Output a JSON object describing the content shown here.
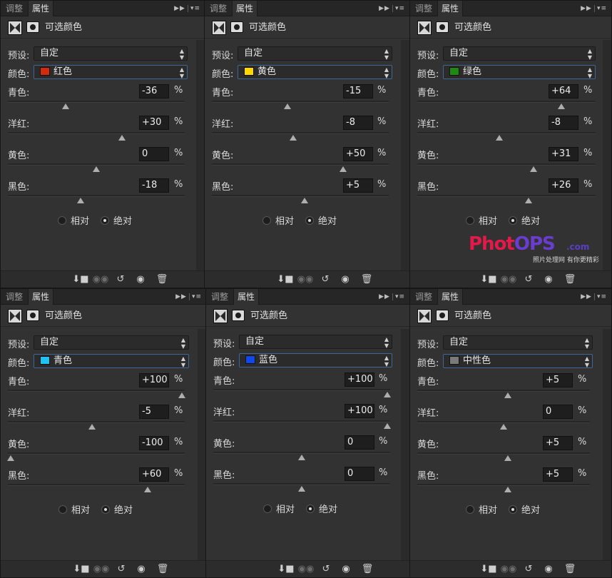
{
  "common": {
    "tab_adjust": "调整",
    "tab_properties": "属性",
    "panel_title": "可选颜色",
    "preset_label": "预设:",
    "preset_value": "自定",
    "color_label": "颜色:",
    "slider_labels": [
      "青色:",
      "洋红:",
      "黄色:",
      "黑色:"
    ],
    "percent": "%",
    "relative": "相对",
    "absolute": "绝对",
    "method": "absolute"
  },
  "panels": [
    {
      "color_name": "红色",
      "swatch": "#d62a0f",
      "values": [
        "-36",
        "+30",
        "0",
        "-18"
      ],
      "levels": [
        -36,
        30,
        0,
        -18
      ]
    },
    {
      "color_name": "黄色",
      "swatch": "#ffd800",
      "values": [
        "-15",
        "-8",
        "+50",
        "+5"
      ],
      "levels": [
        -15,
        -8,
        50,
        5
      ]
    },
    {
      "color_name": "绿色",
      "swatch": "#1f8a12",
      "values": [
        "+64",
        "-8",
        "+31",
        "+26"
      ],
      "levels": [
        64,
        -8,
        31,
        26
      ]
    },
    {
      "color_name": "青色",
      "swatch": "#1ec3f4",
      "values": [
        "+100",
        "-5",
        "-100",
        "+60"
      ],
      "levels": [
        100,
        -5,
        -100,
        60
      ]
    },
    {
      "color_name": "蓝色",
      "swatch": "#1147f0",
      "values": [
        "+100",
        "+100",
        "0",
        "0"
      ],
      "levels": [
        100,
        100,
        0,
        0
      ]
    },
    {
      "color_name": "中性色",
      "swatch": "#7a7a7a",
      "values": [
        "+5",
        "0",
        "+5",
        "+5"
      ],
      "levels": [
        5,
        0,
        5,
        5
      ]
    }
  ],
  "watermark": {
    "brand_a": "Phot",
    "brand_b": "OPS",
    "domain": ".com",
    "tagline": "照片处理网 有你更精彩"
  }
}
